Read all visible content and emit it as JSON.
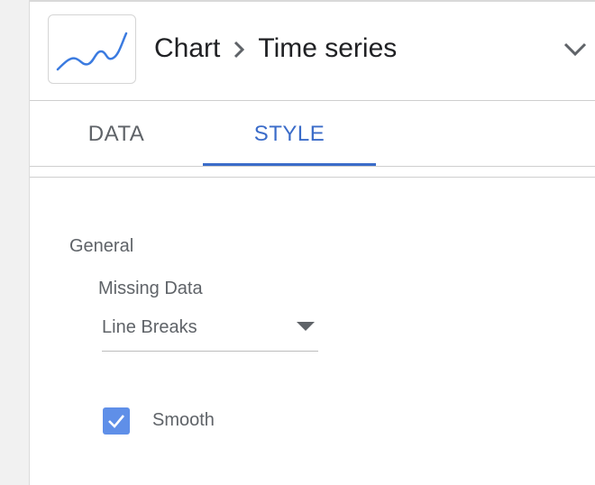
{
  "header": {
    "chart_icon": "time-series-chart-icon",
    "breadcrumb_parent": "Chart",
    "breadcrumb_separator": "›",
    "breadcrumb_current": "Time series",
    "collapse_icon": "chevron-down-icon"
  },
  "tabs": [
    {
      "label": "DATA",
      "active": false
    },
    {
      "label": "STYLE",
      "active": true
    }
  ],
  "colors": {
    "accent": "#3b6cc9",
    "checkbox": "#5f8fe8",
    "text_secondary": "#5f6368",
    "text_primary": "#202124"
  },
  "style": {
    "section_title": "General",
    "missing_data": {
      "label": "Missing Data",
      "value": "Line Breaks",
      "icon": "dropdown-arrow-icon"
    },
    "smooth": {
      "label": "Smooth",
      "checked": true,
      "icon": "checkmark-icon"
    }
  }
}
